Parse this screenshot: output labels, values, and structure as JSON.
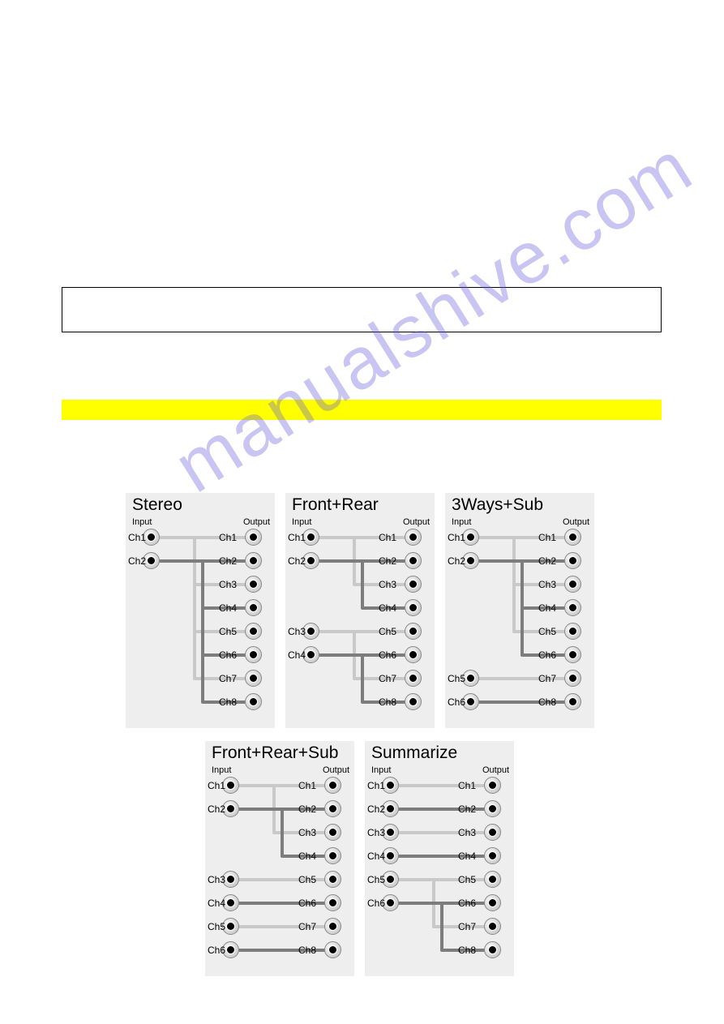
{
  "boxes": {
    "outlined_present": true,
    "yellow_bar_present": true
  },
  "watermark": "manualshive.com",
  "diagrams": [
    {
      "title": "Stereo",
      "input_label": "Input",
      "output_label": "Output",
      "inputs": [
        "Ch1",
        "Ch2"
      ],
      "outputs": [
        "Ch1",
        "Ch2",
        "Ch3",
        "Ch4",
        "Ch5",
        "Ch6",
        "Ch7",
        "Ch8"
      ],
      "routing": [
        {
          "from": "Ch1",
          "to_outputs": [
            "Ch1",
            "Ch3",
            "Ch5",
            "Ch7"
          ],
          "color": "light"
        },
        {
          "from": "Ch2",
          "to_outputs": [
            "Ch2",
            "Ch4",
            "Ch6",
            "Ch8"
          ],
          "color": "dark"
        }
      ]
    },
    {
      "title": "Front+Rear",
      "input_label": "Input",
      "output_label": "Output",
      "inputs": [
        "Ch1",
        "Ch2",
        "Ch3",
        "Ch4"
      ],
      "outputs": [
        "Ch1",
        "Ch2",
        "Ch3",
        "Ch4",
        "Ch5",
        "Ch6",
        "Ch7",
        "Ch8"
      ],
      "routing": [
        {
          "from": "Ch1",
          "to_outputs": [
            "Ch1",
            "Ch3"
          ],
          "color": "light"
        },
        {
          "from": "Ch2",
          "to_outputs": [
            "Ch2",
            "Ch4"
          ],
          "color": "dark"
        },
        {
          "from": "Ch3",
          "to_outputs": [
            "Ch5",
            "Ch7"
          ],
          "color": "light"
        },
        {
          "from": "Ch4",
          "to_outputs": [
            "Ch6",
            "Ch8"
          ],
          "color": "dark"
        }
      ]
    },
    {
      "title": "3Ways+Sub",
      "input_label": "Input",
      "output_label": "Output",
      "inputs": [
        "Ch1",
        "Ch2",
        "Ch5",
        "Ch6"
      ],
      "outputs": [
        "Ch1",
        "Ch2",
        "Ch3",
        "Ch4",
        "Ch5",
        "Ch6",
        "Ch7",
        "Ch8"
      ],
      "routing": [
        {
          "from": "Ch1",
          "to_outputs": [
            "Ch1",
            "Ch3",
            "Ch5"
          ],
          "color": "light"
        },
        {
          "from": "Ch2",
          "to_outputs": [
            "Ch2",
            "Ch4",
            "Ch6"
          ],
          "color": "dark"
        },
        {
          "from": "Ch5",
          "to_outputs": [
            "Ch7"
          ],
          "color": "light"
        },
        {
          "from": "Ch6",
          "to_outputs": [
            "Ch8"
          ],
          "color": "dark"
        }
      ]
    },
    {
      "title": "Front+Rear+Sub",
      "input_label": "Input",
      "output_label": "Output",
      "inputs": [
        "Ch1",
        "Ch2",
        "Ch3",
        "Ch4",
        "Ch5",
        "Ch6"
      ],
      "outputs": [
        "Ch1",
        "Ch2",
        "Ch3",
        "Ch4",
        "Ch5",
        "Ch6",
        "Ch7",
        "Ch8"
      ],
      "routing": [
        {
          "from": "Ch1",
          "to_outputs": [
            "Ch1",
            "Ch3"
          ],
          "color": "light"
        },
        {
          "from": "Ch2",
          "to_outputs": [
            "Ch2",
            "Ch4"
          ],
          "color": "dark"
        },
        {
          "from": "Ch3",
          "to_outputs": [
            "Ch5"
          ],
          "color": "light"
        },
        {
          "from": "Ch4",
          "to_outputs": [
            "Ch6"
          ],
          "color": "dark"
        },
        {
          "from": "Ch5",
          "to_outputs": [
            "Ch7"
          ],
          "color": "light"
        },
        {
          "from": "Ch6",
          "to_outputs": [
            "Ch8"
          ],
          "color": "dark"
        }
      ]
    },
    {
      "title": "Summarize",
      "input_label": "Input",
      "output_label": "Output",
      "inputs": [
        "Ch1",
        "Ch2",
        "Ch3",
        "Ch4",
        "Ch5",
        "Ch6"
      ],
      "outputs": [
        "Ch1",
        "Ch2",
        "Ch3",
        "Ch4",
        "Ch5",
        "Ch6",
        "Ch7",
        "Ch8"
      ],
      "routing": [
        {
          "from": "Ch1",
          "to_outputs": [
            "Ch1"
          ],
          "color": "light"
        },
        {
          "from": "Ch2",
          "to_outputs": [
            "Ch2"
          ],
          "color": "dark"
        },
        {
          "from": "Ch3",
          "to_outputs": [
            "Ch3"
          ],
          "color": "light"
        },
        {
          "from": "Ch4",
          "to_outputs": [
            "Ch4"
          ],
          "color": "dark"
        },
        {
          "from": "Ch5",
          "to_outputs": [
            "Ch5",
            "Ch7"
          ],
          "color": "light"
        },
        {
          "from": "Ch6",
          "to_outputs": [
            "Ch6",
            "Ch8"
          ],
          "color": "dark"
        }
      ]
    }
  ]
}
